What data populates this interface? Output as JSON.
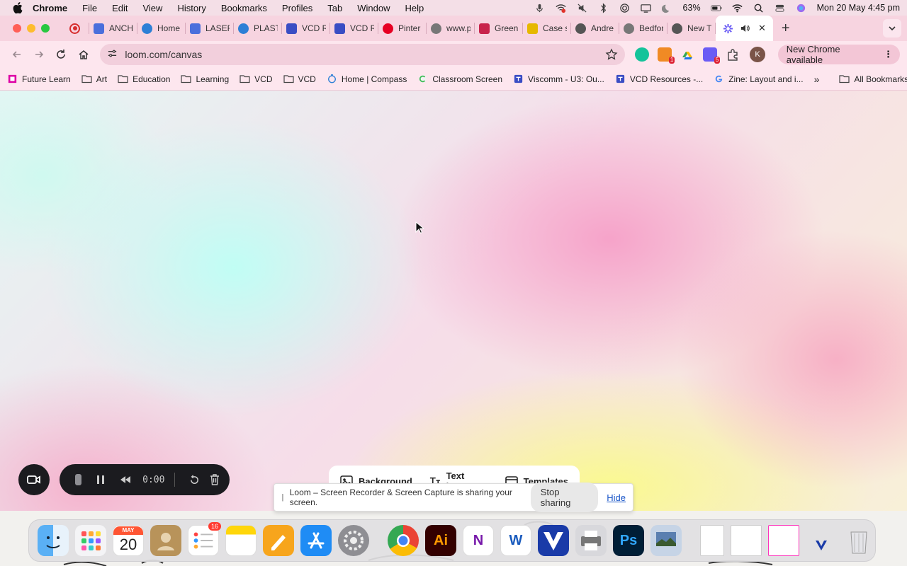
{
  "menubar": {
    "app_name": "Chrome",
    "items": [
      "File",
      "Edit",
      "View",
      "History",
      "Bookmarks",
      "Profiles",
      "Tab",
      "Window",
      "Help"
    ],
    "battery": "63%",
    "clock": "Mon 20 May  4:45 pm"
  },
  "tabs": [
    {
      "title": "",
      "color": "#d62d2d",
      "icon": "record-icon"
    },
    {
      "title": "ANCH",
      "color": "#4a6fdc",
      "icon": "page-icon"
    },
    {
      "title": "Home",
      "color": "#2d7fd6",
      "icon": "compass-icon"
    },
    {
      "title": "LASER",
      "color": "#4a6fdc",
      "icon": "page-icon"
    },
    {
      "title": "PLAST",
      "color": "#2d7fd6",
      "icon": "compass-icon"
    },
    {
      "title": "VCD R",
      "color": "#3a4dc4",
      "icon": "teams-icon"
    },
    {
      "title": "VCD R",
      "color": "#3a4dc4",
      "icon": "teams-icon"
    },
    {
      "title": "Pinter",
      "color": "#e60023",
      "icon": "pinterest-icon"
    },
    {
      "title": "www.p",
      "color": "#777777",
      "icon": "globe-icon"
    },
    {
      "title": "Green",
      "color": "#c8234b",
      "icon": "mendeley-icon"
    },
    {
      "title": "Case s",
      "color": "#e6b800",
      "icon": "folder-icon"
    },
    {
      "title": "Andre",
      "color": "#555555",
      "icon": "profile-icon"
    },
    {
      "title": "Bedfor",
      "color": "#777777",
      "icon": "globe-icon"
    },
    {
      "title": "New T",
      "color": "#555555",
      "icon": "chrome-icon"
    }
  ],
  "active_tab": {
    "title": "",
    "color": "#6a5cf5",
    "icon": "loom-icon"
  },
  "address_bar": {
    "url": "loom.com/canvas"
  },
  "update_button": "New Chrome available",
  "profile_initial": "K",
  "extensions": [
    {
      "name": "grammarly-icon",
      "color": "#15c39a",
      "badge": ""
    },
    {
      "name": "extension-orange-icon",
      "color": "#f08a24",
      "badge": "1"
    },
    {
      "name": "drive-icon",
      "color": "#1a73e8",
      "badge": ""
    },
    {
      "name": "loom-ext-icon",
      "color": "#6a5cf5",
      "badge": "5"
    },
    {
      "name": "puzzle-icon",
      "color": "#555555",
      "badge": ""
    }
  ],
  "bookmarks": [
    {
      "label": "Future Learn",
      "icon": "futurelearn-icon"
    },
    {
      "label": "Art",
      "icon": "folder-icon"
    },
    {
      "label": "Education",
      "icon": "folder-icon"
    },
    {
      "label": "Learning",
      "icon": "folder-icon"
    },
    {
      "label": "VCD",
      "icon": "folder-icon"
    },
    {
      "label": "VCD",
      "icon": "folder-icon"
    },
    {
      "label": "Home | Compass",
      "icon": "compass-icon"
    },
    {
      "label": "Classroom Screen",
      "icon": "classroomscreen-icon"
    },
    {
      "label": "Viscomm - U3: Ou...",
      "icon": "teams-icon"
    },
    {
      "label": "VCD Resources -...",
      "icon": "teams-icon"
    },
    {
      "label": "Zine: Layout and i...",
      "icon": "google-icon"
    }
  ],
  "all_bookmarks": "All Bookmarks",
  "loom": {
    "timer": "0:00",
    "tools": [
      "Background",
      "Text layout",
      "Templates"
    ]
  },
  "share_notice": {
    "message": "Loom – Screen Recorder & Screen Capture is sharing your screen.",
    "stop_label": "Stop sharing",
    "hide_label": "Hide"
  },
  "dock": {
    "calendar_month": "MAY",
    "calendar_day": "20",
    "reminders_badge": "16"
  }
}
